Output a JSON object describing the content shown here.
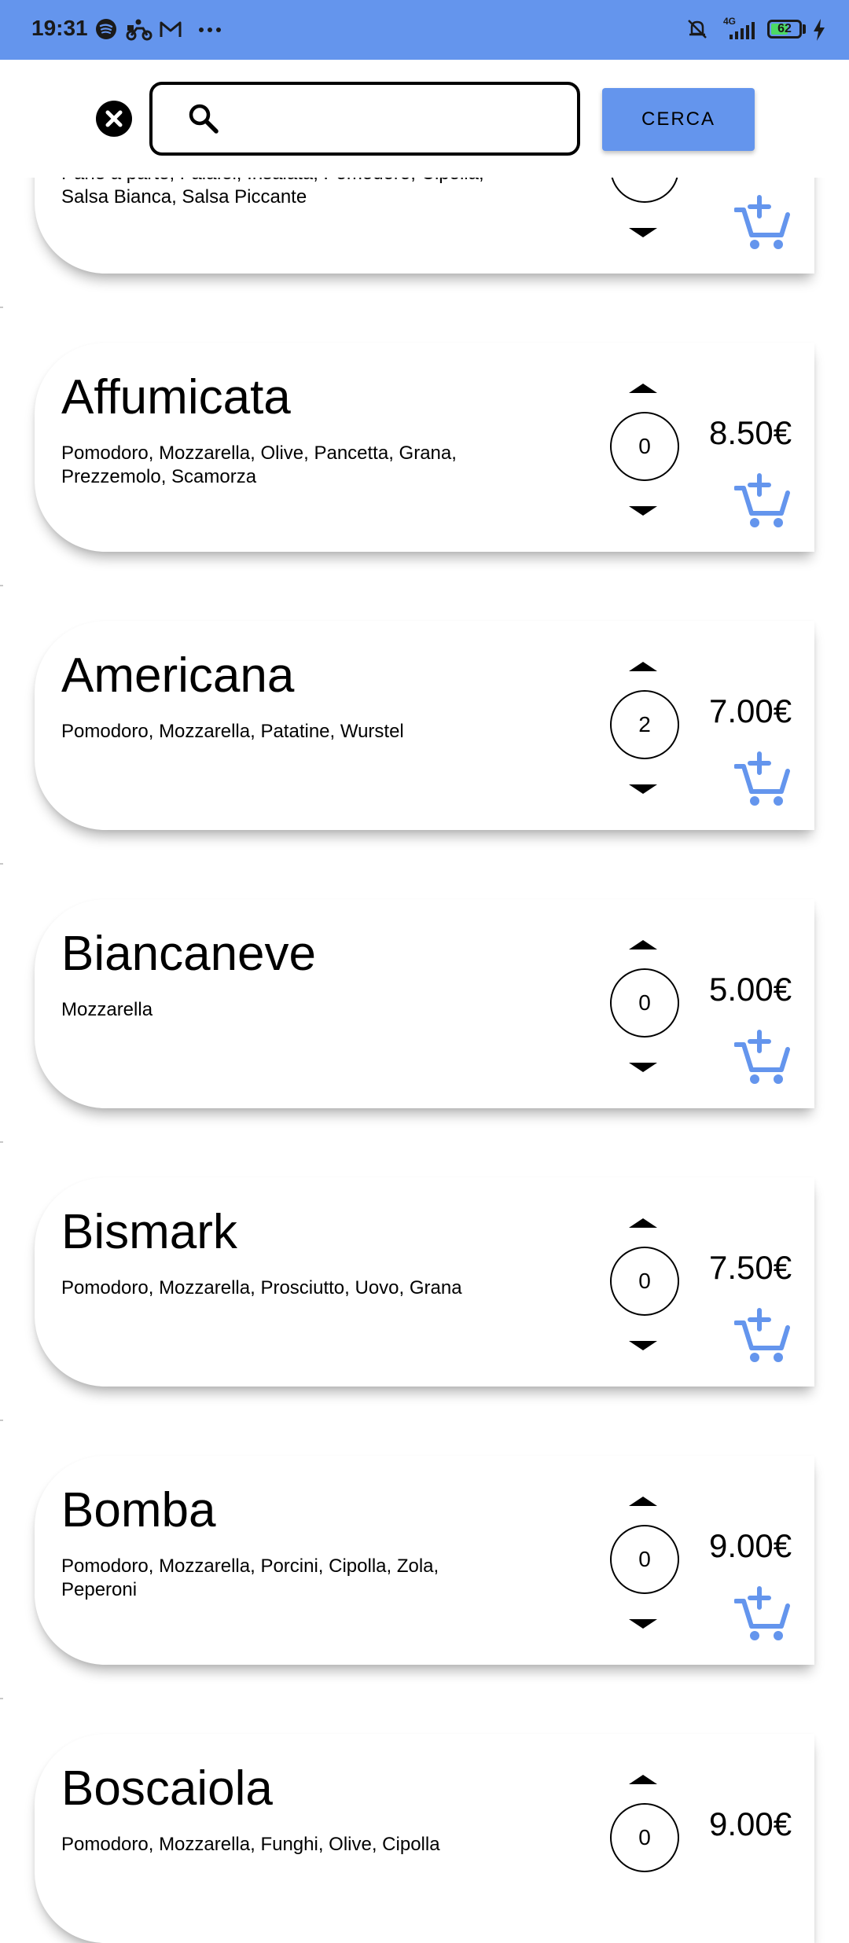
{
  "status_bar": {
    "time": "19:31",
    "network": "4G",
    "battery": "62",
    "battery_level": 0.62,
    "icons": [
      "spotify-icon",
      "delivery-scooter-icon",
      "gmail-icon",
      "more-dots-icon",
      "bell-off-icon",
      "signal-icon",
      "battery-icon",
      "charging-icon"
    ]
  },
  "search": {
    "placeholder": "",
    "value": "",
    "button_label": "CERCA"
  },
  "colors": {
    "accent": "#6495ed",
    "battery_fill": "#4cd964"
  },
  "products": [
    {
      "name": "",
      "description": "Pane a parte, Falafel, Insalata, Pomodoro, Cipolla, Salsa Bianca, Salsa Piccante",
      "quantity": "",
      "price": ""
    },
    {
      "name": "Affumicata",
      "description": "Pomodoro, Mozzarella, Olive, Pancetta, Grana, Prezzemolo, Scamorza",
      "quantity": "0",
      "price": "8.50€"
    },
    {
      "name": "Americana",
      "description": "Pomodoro, Mozzarella, Patatine, Wurstel",
      "quantity": "2",
      "price": "7.00€"
    },
    {
      "name": "Biancaneve",
      "description": "Mozzarella",
      "quantity": "0",
      "price": "5.00€"
    },
    {
      "name": "Bismark",
      "description": "Pomodoro, Mozzarella, Prosciutto, Uovo, Grana",
      "quantity": "0",
      "price": "7.50€"
    },
    {
      "name": "Bomba",
      "description": "Pomodoro, Mozzarella, Porcini, Cipolla, Zola, Peperoni",
      "quantity": "0",
      "price": "9.00€"
    },
    {
      "name": "Boscaiola",
      "description": "Pomodoro, Mozzarella, Funghi, Olive, Cipolla",
      "quantity": "0",
      "price": "9.00€"
    }
  ]
}
